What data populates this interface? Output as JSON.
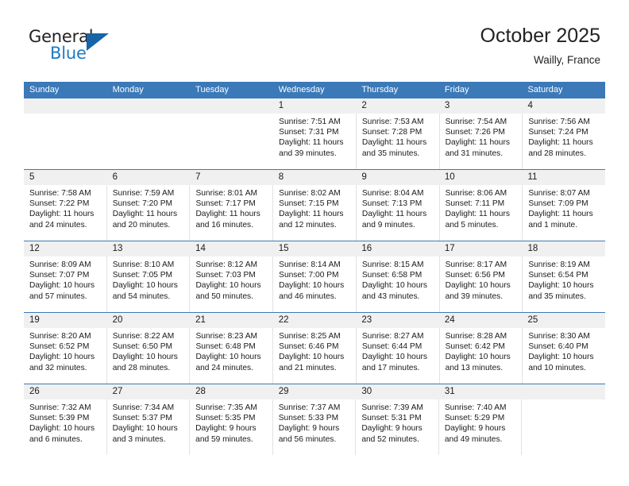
{
  "brand": {
    "name_top": "General",
    "name_bottom": "Blue",
    "color_dark": "#231f20",
    "color_blue": "#1e7bc4",
    "triangle_color": "#1565a8"
  },
  "header": {
    "title": "October 2025",
    "location": "Wailly, France"
  },
  "theme": {
    "header_blue": "#3b79b8",
    "day_band_gray": "#f0f0f0",
    "cell_divider": "#e2e2e2",
    "text": "#1a1a1a"
  },
  "weekday_headers": [
    "Sunday",
    "Monday",
    "Tuesday",
    "Wednesday",
    "Thursday",
    "Friday",
    "Saturday"
  ],
  "weeks": [
    {
      "days": [
        {
          "number": "",
          "lines": []
        },
        {
          "number": "",
          "lines": []
        },
        {
          "number": "",
          "lines": []
        },
        {
          "number": "1",
          "lines": [
            "Sunrise: 7:51 AM",
            "Sunset: 7:31 PM",
            "Daylight: 11 hours",
            "and 39 minutes."
          ]
        },
        {
          "number": "2",
          "lines": [
            "Sunrise: 7:53 AM",
            "Sunset: 7:28 PM",
            "Daylight: 11 hours",
            "and 35 minutes."
          ]
        },
        {
          "number": "3",
          "lines": [
            "Sunrise: 7:54 AM",
            "Sunset: 7:26 PM",
            "Daylight: 11 hours",
            "and 31 minutes."
          ]
        },
        {
          "number": "4",
          "lines": [
            "Sunrise: 7:56 AM",
            "Sunset: 7:24 PM",
            "Daylight: 11 hours",
            "and 28 minutes."
          ]
        }
      ]
    },
    {
      "days": [
        {
          "number": "5",
          "lines": [
            "Sunrise: 7:58 AM",
            "Sunset: 7:22 PM",
            "Daylight: 11 hours",
            "and 24 minutes."
          ]
        },
        {
          "number": "6",
          "lines": [
            "Sunrise: 7:59 AM",
            "Sunset: 7:20 PM",
            "Daylight: 11 hours",
            "and 20 minutes."
          ]
        },
        {
          "number": "7",
          "lines": [
            "Sunrise: 8:01 AM",
            "Sunset: 7:17 PM",
            "Daylight: 11 hours",
            "and 16 minutes."
          ]
        },
        {
          "number": "8",
          "lines": [
            "Sunrise: 8:02 AM",
            "Sunset: 7:15 PM",
            "Daylight: 11 hours",
            "and 12 minutes."
          ]
        },
        {
          "number": "9",
          "lines": [
            "Sunrise: 8:04 AM",
            "Sunset: 7:13 PM",
            "Daylight: 11 hours",
            "and 9 minutes."
          ]
        },
        {
          "number": "10",
          "lines": [
            "Sunrise: 8:06 AM",
            "Sunset: 7:11 PM",
            "Daylight: 11 hours",
            "and 5 minutes."
          ]
        },
        {
          "number": "11",
          "lines": [
            "Sunrise: 8:07 AM",
            "Sunset: 7:09 PM",
            "Daylight: 11 hours",
            "and 1 minute."
          ]
        }
      ]
    },
    {
      "days": [
        {
          "number": "12",
          "lines": [
            "Sunrise: 8:09 AM",
            "Sunset: 7:07 PM",
            "Daylight: 10 hours",
            "and 57 minutes."
          ]
        },
        {
          "number": "13",
          "lines": [
            "Sunrise: 8:10 AM",
            "Sunset: 7:05 PM",
            "Daylight: 10 hours",
            "and 54 minutes."
          ]
        },
        {
          "number": "14",
          "lines": [
            "Sunrise: 8:12 AM",
            "Sunset: 7:03 PM",
            "Daylight: 10 hours",
            "and 50 minutes."
          ]
        },
        {
          "number": "15",
          "lines": [
            "Sunrise: 8:14 AM",
            "Sunset: 7:00 PM",
            "Daylight: 10 hours",
            "and 46 minutes."
          ]
        },
        {
          "number": "16",
          "lines": [
            "Sunrise: 8:15 AM",
            "Sunset: 6:58 PM",
            "Daylight: 10 hours",
            "and 43 minutes."
          ]
        },
        {
          "number": "17",
          "lines": [
            "Sunrise: 8:17 AM",
            "Sunset: 6:56 PM",
            "Daylight: 10 hours",
            "and 39 minutes."
          ]
        },
        {
          "number": "18",
          "lines": [
            "Sunrise: 8:19 AM",
            "Sunset: 6:54 PM",
            "Daylight: 10 hours",
            "and 35 minutes."
          ]
        }
      ]
    },
    {
      "days": [
        {
          "number": "19",
          "lines": [
            "Sunrise: 8:20 AM",
            "Sunset: 6:52 PM",
            "Daylight: 10 hours",
            "and 32 minutes."
          ]
        },
        {
          "number": "20",
          "lines": [
            "Sunrise: 8:22 AM",
            "Sunset: 6:50 PM",
            "Daylight: 10 hours",
            "and 28 minutes."
          ]
        },
        {
          "number": "21",
          "lines": [
            "Sunrise: 8:23 AM",
            "Sunset: 6:48 PM",
            "Daylight: 10 hours",
            "and 24 minutes."
          ]
        },
        {
          "number": "22",
          "lines": [
            "Sunrise: 8:25 AM",
            "Sunset: 6:46 PM",
            "Daylight: 10 hours",
            "and 21 minutes."
          ]
        },
        {
          "number": "23",
          "lines": [
            "Sunrise: 8:27 AM",
            "Sunset: 6:44 PM",
            "Daylight: 10 hours",
            "and 17 minutes."
          ]
        },
        {
          "number": "24",
          "lines": [
            "Sunrise: 8:28 AM",
            "Sunset: 6:42 PM",
            "Daylight: 10 hours",
            "and 13 minutes."
          ]
        },
        {
          "number": "25",
          "lines": [
            "Sunrise: 8:30 AM",
            "Sunset: 6:40 PM",
            "Daylight: 10 hours",
            "and 10 minutes."
          ]
        }
      ]
    },
    {
      "days": [
        {
          "number": "26",
          "lines": [
            "Sunrise: 7:32 AM",
            "Sunset: 5:39 PM",
            "Daylight: 10 hours",
            "and 6 minutes."
          ]
        },
        {
          "number": "27",
          "lines": [
            "Sunrise: 7:34 AM",
            "Sunset: 5:37 PM",
            "Daylight: 10 hours",
            "and 3 minutes."
          ]
        },
        {
          "number": "28",
          "lines": [
            "Sunrise: 7:35 AM",
            "Sunset: 5:35 PM",
            "Daylight: 9 hours",
            "and 59 minutes."
          ]
        },
        {
          "number": "29",
          "lines": [
            "Sunrise: 7:37 AM",
            "Sunset: 5:33 PM",
            "Daylight: 9 hours",
            "and 56 minutes."
          ]
        },
        {
          "number": "30",
          "lines": [
            "Sunrise: 7:39 AM",
            "Sunset: 5:31 PM",
            "Daylight: 9 hours",
            "and 52 minutes."
          ]
        },
        {
          "number": "31",
          "lines": [
            "Sunrise: 7:40 AM",
            "Sunset: 5:29 PM",
            "Daylight: 9 hours",
            "and 49 minutes."
          ]
        },
        {
          "number": "",
          "lines": []
        }
      ]
    }
  ]
}
